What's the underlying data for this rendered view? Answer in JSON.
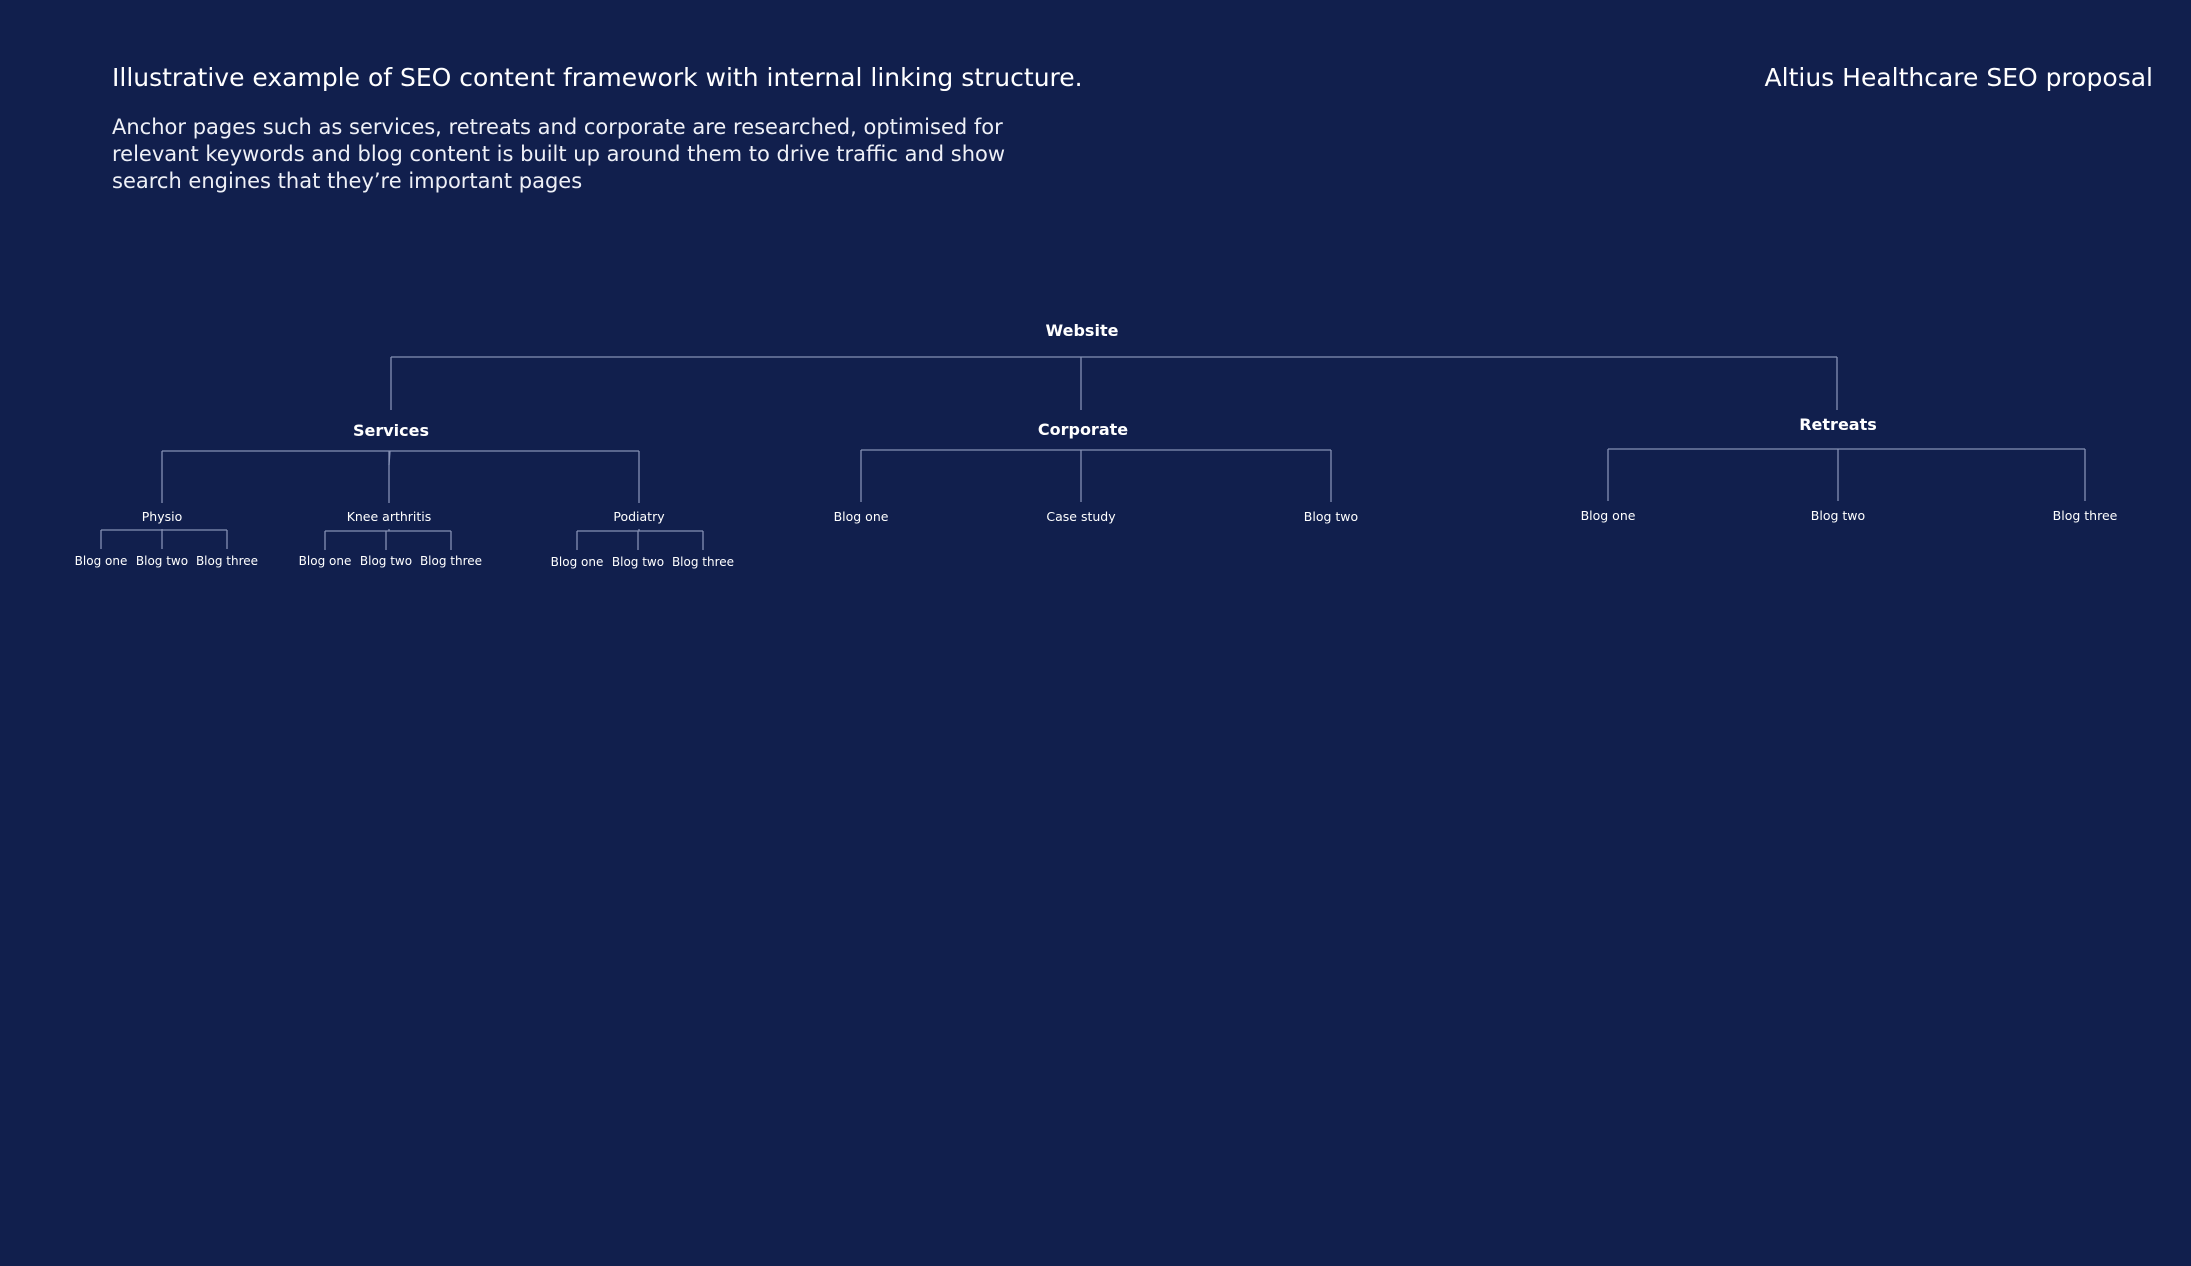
{
  "header": {
    "heading": "Illustrative example of SEO content framework with internal linking structure.",
    "proposal_label": "Altius Healthcare SEO proposal",
    "description": "Anchor pages such as services, retreats and corporate are researched, optimised for relevant keywords and blog content is built up around them to drive traffic and show search engines that they’re important pages"
  },
  "colors": {
    "background": "#111f4d",
    "text": "#ffffff",
    "connector": "#8590b4"
  },
  "tree": {
    "label": "Website",
    "children": [
      {
        "label": "Services",
        "children": [
          {
            "label": "Physio",
            "children": [
              {
                "label": "Blog one"
              },
              {
                "label": "Blog two"
              },
              {
                "label": "Blog three"
              }
            ]
          },
          {
            "label": "Knee arthritis",
            "children": [
              {
                "label": "Blog one"
              },
              {
                "label": "Blog two"
              },
              {
                "label": "Blog three"
              }
            ]
          },
          {
            "label": "Podiatry",
            "children": [
              {
                "label": "Blog one"
              },
              {
                "label": "Blog two"
              },
              {
                "label": "Blog three"
              }
            ]
          }
        ]
      },
      {
        "label": "Corporate",
        "children": [
          {
            "label": "Blog one"
          },
          {
            "label": "Case study"
          },
          {
            "label": "Blog two"
          }
        ]
      },
      {
        "label": "Retreats",
        "children": [
          {
            "label": "Blog one"
          },
          {
            "label": "Blog two"
          },
          {
            "label": "Blog three"
          }
        ]
      }
    ]
  }
}
